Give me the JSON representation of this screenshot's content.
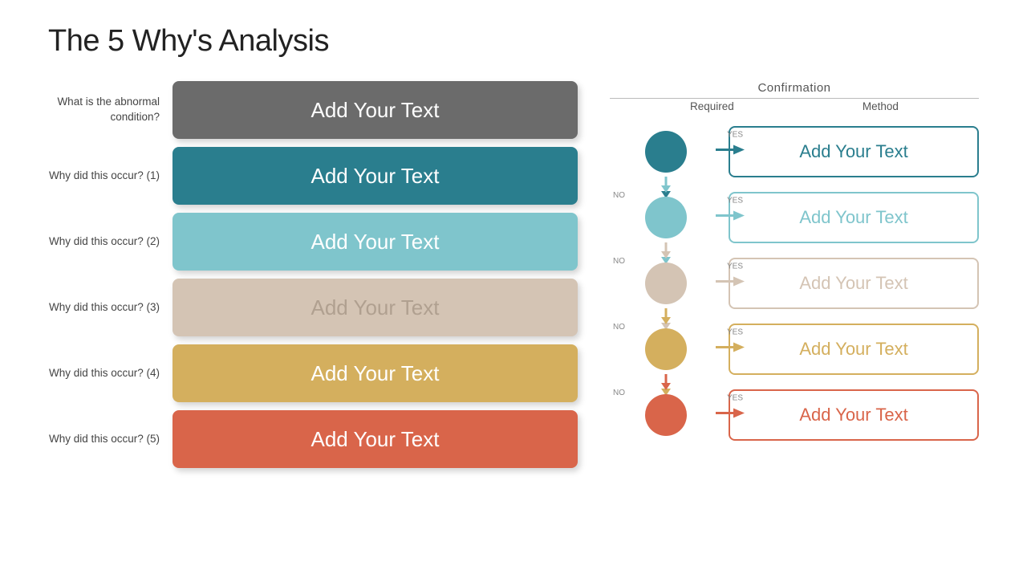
{
  "title": "The 5 Why's Analysis",
  "left": {
    "rows": [
      {
        "label": "What is the abnormal condition?",
        "text": "Add Your Text",
        "boxClass": "box-gray"
      },
      {
        "label": "Why did this occur? (1)",
        "text": "Add Your Text",
        "boxClass": "box-teal"
      },
      {
        "label": "Why did this occur? (2)",
        "text": "Add Your Text",
        "boxClass": "box-ltblue"
      },
      {
        "label": "Why did this occur? (3)",
        "text": "Add Your Text",
        "boxClass": "box-beige"
      },
      {
        "label": "Why did this occur? (4)",
        "text": "Add Your Text",
        "boxClass": "box-yellow"
      },
      {
        "label": "Why did this occur? (5)",
        "text": "Add Your Text",
        "boxClass": "box-orange"
      }
    ]
  },
  "right": {
    "header": "Confirmation",
    "sub_required": "Required",
    "sub_method": "Method",
    "rows": [
      {
        "text": "Add Your Text",
        "confClass": "conf-teal",
        "circleClass": "circle-teal",
        "arrowColor": "#2a7e8e",
        "arrowDownColor": "#2a7e8e"
      },
      {
        "text": "Add Your Text",
        "confClass": "conf-ltblue",
        "circleClass": "circle-ltblue",
        "arrowColor": "#7fc5cc",
        "arrowDownColor": "#7fc5cc"
      },
      {
        "text": "Add Your Text",
        "confClass": "conf-beige",
        "circleClass": "circle-beige",
        "arrowColor": "#d4c4b4",
        "arrowDownColor": "#d4c4b4"
      },
      {
        "text": "Add Your Text",
        "confClass": "conf-yellow",
        "circleClass": "circle-yellow",
        "arrowColor": "#d4af5e",
        "arrowDownColor": "#d4af5e"
      },
      {
        "text": "Add Your Text",
        "confClass": "conf-orange",
        "circleClass": "circle-orange",
        "arrowColor": "#d9654a",
        "arrowDownColor": "#d9654a"
      }
    ]
  }
}
